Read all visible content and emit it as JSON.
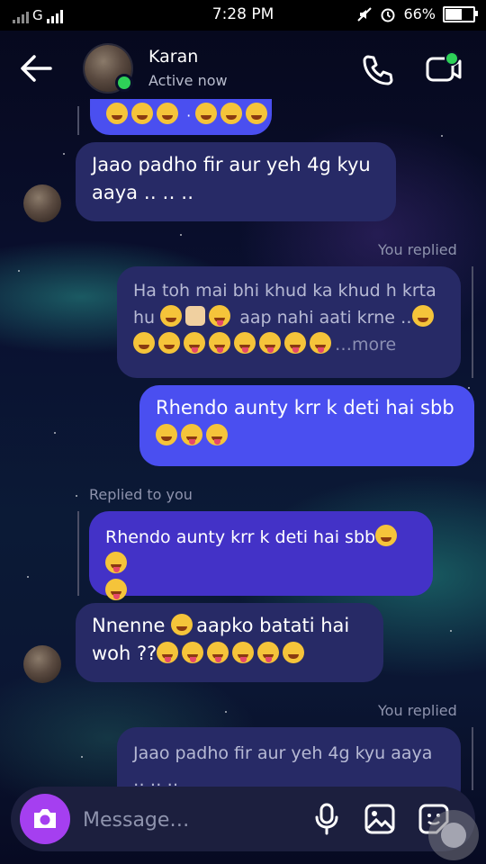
{
  "status_bar": {
    "network": "G",
    "time": "7:28 PM",
    "battery": "66%",
    "battery_level": 0.66
  },
  "header": {
    "contact_name": "Karan",
    "presence": "Active now"
  },
  "messages": {
    "m1_text": "Jaao padho fir aur yeh 4g kyu aaya ․․ ․․ ․․",
    "you_replied_1": "You replied",
    "m2_text": "Ha toh mai bhi khud ka khud h krta hu",
    "m2_text_b": "aap nahi aati krne",
    "m2_more": "…more",
    "m3_text": "Rhendo aunty krr k deti hai sbb",
    "replied_to_you": "Replied to you",
    "m4_quote": "Rhendo aunty krr k deti hai sbb",
    "m5_text_a": "Nnenne",
    "m5_text_b": "aapko batati hai woh ??",
    "you_replied_2": "You replied",
    "m6_quote": "Jaao padho fir aur yeh 4g kyu aaya",
    "m6_quote_b": "․․ ․․ ․․"
  },
  "composer": {
    "placeholder": "Message…"
  },
  "colors": {
    "accent_blue": "#4a4ff0",
    "camera_purple": "#a53ff0",
    "incoming_bubble": "#272a66",
    "online_green": "#2ed158"
  },
  "icons": [
    "back-arrow-icon",
    "phone-icon",
    "video-call-icon",
    "camera-icon",
    "microphone-icon",
    "image-icon",
    "sticker-icon"
  ]
}
